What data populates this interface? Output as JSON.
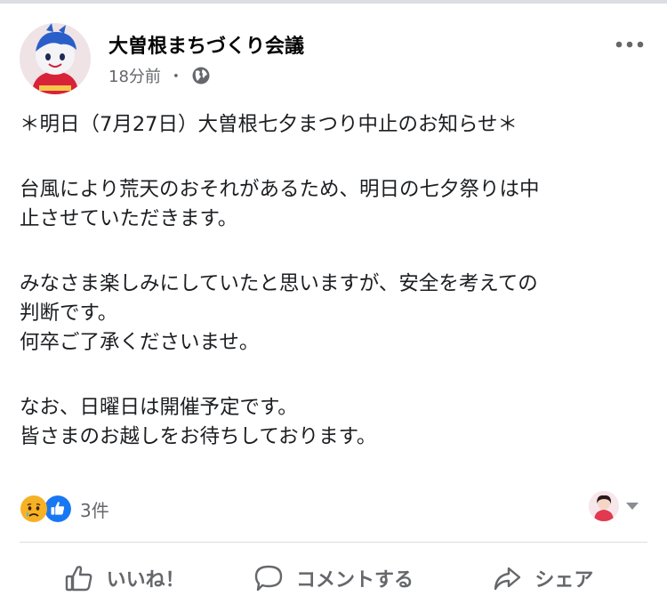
{
  "post": {
    "page_name": "大曽根まちづくり会議",
    "time": "18分前",
    "separator": "・",
    "privacy_icon": "globe-icon",
    "more_icon": "more-horizontal-icon",
    "lines": [
      "＊明日（7月27日）大曽根七夕まつり中止のお知らせ＊",
      "台風により荒天のおそれがあるため、明日の七夕祭りは中",
      "止させていただきます。",
      "みなさま楽しみにしていたと思いますが、安全を考えての",
      "判断です。",
      "何卒ご了承くださいませ。",
      "なお、日曜日は開催予定です。",
      "皆さまのお越しをお待ちしております。"
    ]
  },
  "reactions": {
    "icons": [
      "sad-reaction-icon",
      "like-reaction-icon"
    ],
    "count": "3件"
  },
  "actions": {
    "like": "いいね！",
    "comment": "コメントする",
    "share": "シェア"
  },
  "colors": {
    "text": "#1c1e21",
    "secondary": "#65676b",
    "like_blue": "#1877f2",
    "sad_yellow": "#f7b125",
    "divider": "#dadde1"
  }
}
